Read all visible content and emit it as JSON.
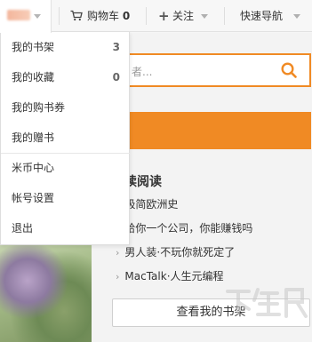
{
  "topbar": {
    "cart_label": "购物车",
    "cart_count": "0",
    "follow_label": "关注",
    "quicknav_label": "快速导航"
  },
  "dropdown": {
    "items": [
      {
        "label": "我的书架",
        "count": "3"
      },
      {
        "label": "我的收藏",
        "count": "0"
      },
      {
        "label": "我的购书券",
        "count": ""
      },
      {
        "label": "我的赠书",
        "count": ""
      },
      {
        "label": "米币中心",
        "count": ""
      },
      {
        "label": "帐号设置",
        "count": ""
      },
      {
        "label": "退出",
        "count": ""
      }
    ]
  },
  "search": {
    "placeholder_fragment": "者..."
  },
  "reading": {
    "title_fragment": "读阅读",
    "books": [
      "极简欧洲史",
      "给你一个公司，你能赚钱吗",
      "男人装·不玩你就死定了",
      "MacTalk·人生元编程"
    ],
    "shelf_button": "查看我的书架"
  },
  "colors": {
    "accent": "#f08a24"
  },
  "icons": {
    "cart": "shopping-cart-icon",
    "follow": "plus-icon",
    "search": "search-icon"
  }
}
